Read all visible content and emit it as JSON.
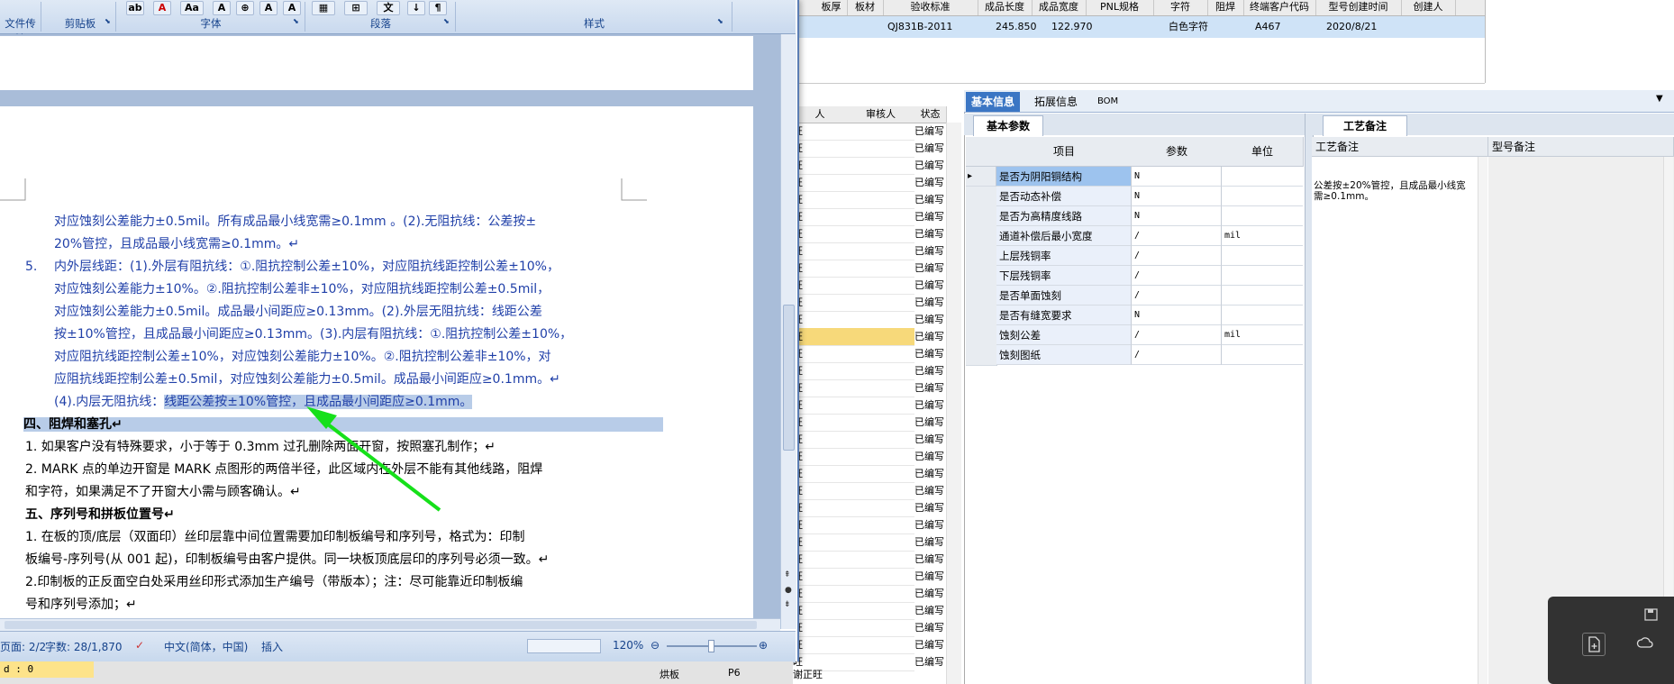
{
  "erp": {
    "top_headers": [
      "板厚",
      "板材",
      "验收标准",
      "成品长度",
      "成品宽度",
      "PNL规格",
      "字符",
      "阻焊",
      "终端客户代码",
      "型号创建时间",
      "创建人"
    ],
    "selected_row": {
      "standard": "QJ831B-2011",
      "length": "245.850",
      "width": "122.970",
      "char": "白色字符",
      "cust_code": "A467",
      "date": "2020/8/21"
    },
    "list_headers": [
      "人",
      "审核人",
      "状态"
    ],
    "list_status": [
      "已编写",
      "已编写",
      "已编写",
      "已编写",
      "已编写",
      "已编写",
      "已编写",
      "已编写",
      "已编写",
      "已编写",
      "已编写",
      "已编写",
      "已编写",
      "已编写",
      "已编写",
      "已编写",
      "已编写",
      "已编写",
      "已编写",
      "已编写",
      "已编写",
      "已编写",
      "已编写",
      "已编写",
      "已编写",
      "已编写",
      "已编写",
      "已编写",
      "已编写",
      "已编写",
      "已编写",
      "已编写"
    ],
    "list_prefix": "旺",
    "bottom_items": [
      "烘板",
      "P6",
      "谢正旺"
    ],
    "tabs": [
      "基本信息",
      "拓展信息",
      "BOM"
    ],
    "subtab": "基本参数",
    "param_headers": {
      "item": "项目",
      "param": "参数",
      "unit": "单位"
    },
    "params": [
      {
        "item": "是否为阴阳铜结构",
        "param": "N",
        "unit": ""
      },
      {
        "item": "是否动态补偿",
        "param": "N",
        "unit": ""
      },
      {
        "item": "是否为高精度线路",
        "param": "N",
        "unit": ""
      },
      {
        "item": "通道补偿后最小宽度",
        "param": "/",
        "unit": "mil"
      },
      {
        "item": "上层残铜率",
        "param": "/",
        "unit": ""
      },
      {
        "item": "下层残铜率",
        "param": "/",
        "unit": ""
      },
      {
        "item": "是否单面蚀刻",
        "param": "/",
        "unit": ""
      },
      {
        "item": "是否有缝宽要求",
        "param": "N",
        "unit": ""
      },
      {
        "item": "蚀刻公差",
        "param": "/",
        "unit": "mil"
      },
      {
        "item": "蚀刻图纸",
        "param": "/",
        "unit": ""
      }
    ],
    "notes_tab": "工艺备注",
    "notes_headers": {
      "left": "工艺备注",
      "right": "型号备注"
    },
    "notes_text": "公差按±20%管控，且成品最小线宽需≥0.1mm。"
  },
  "word": {
    "ribbon_groups": [
      "文件传输",
      "剪贴板",
      "字体",
      "段落",
      "样式"
    ],
    "doc_lines": {
      "l1": "对应蚀刻公差能力±0.5mil。所有成品最小线宽需≥0.1mm 。(2).无阻抗线：公差按±",
      "l2": "20%管控，且成品最小线宽需≥0.1mm。↵",
      "l3_num": "5.",
      "l3": "内外层线距：(1).外层有阻抗线：①.阻抗控制公差±10%，对应阻抗线距控制公差±10%，",
      "l4": "对应蚀刻公差能力±10%。②.阻抗控制公差非±10%，对应阻抗线距控制公差±0.5mil，",
      "l5": "对应蚀刻公差能力±0.5mil。成品最小间距应≥0.13mm。(2).外层无阻抗线：线距公差",
      "l6": "按±10%管控，且成品最小间距应≥0.13mm。(3).内层有阻抗线：①.阻抗控制公差±10%，",
      "l7": "对应阻抗线距控制公差±10%，对应蚀刻公差能力±10%。②.阻抗控制公差非±10%，对",
      "l8": "应阻抗线距控制公差±0.5mil，对应蚀刻公差能力±0.5mil。成品最小间距应≥0.1mm。↵",
      "l9a": "(4).内层无阻抗线：",
      "l9b": "线距公差按±10%管控，且成品最小间距应≥0.1mm。",
      "h4": "四、阻焊和塞孔↵",
      "p1": "1. 如果客户没有特殊要求，小于等于 0.3mm 过孔删除两面开窗，按照塞孔制作；↵",
      "p2a": "2. MARK 点的单边开窗是 MARK 点图形的两倍半径，此区域内在外层不能有其他线路，阻焊",
      "p2b": "和字符，如果满足不了开窗大小需与顾客确认。↵",
      "h5": "五、序列号和拼板位置号↵",
      "p3a": "1. 在板的顶/底层（双面印）丝印层靠中间位置需要加印制板编号和序列号，格式为：印制",
      "p3b": "板编号-序列号(从 001 起)，印制板编号由客户提供。同一块板顶底层印的序列号必须一致。↵",
      "p4a": "2.印制板的正反面空白处采用丝印形式添加生产编号（带版本）；注：尽可能靠近印制板编",
      "p4b": "号和序列号添加；↵"
    },
    "status": {
      "page": "页面: 2/2",
      "words": "字数: 28/1,870",
      "lang": "中文(简体，中国)",
      "mode": "插入",
      "zoom": "120%"
    },
    "yellow_box": "d : 0"
  },
  "colors": {
    "arrow": "#16e01a",
    "accent": "#3b76c4"
  }
}
